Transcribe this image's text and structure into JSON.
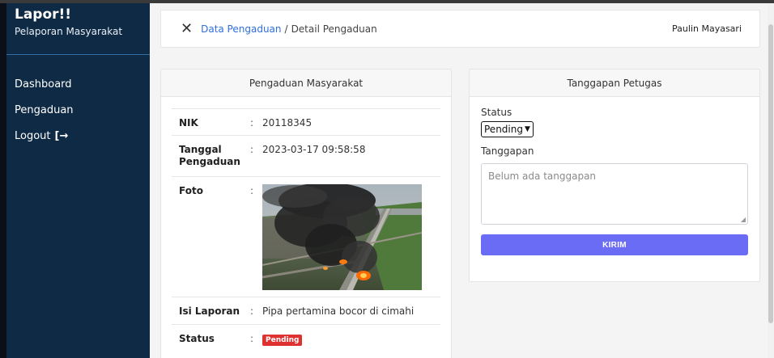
{
  "sidebar": {
    "brand_title": "Lapor!!",
    "brand_subtitle": "Pelaporan Masyarakat",
    "items": [
      {
        "label": "Dashboard"
      },
      {
        "label": "Pengaduan"
      },
      {
        "label": "Logout",
        "icon": "logout-arrow-icon",
        "icon_glyph": "[→"
      }
    ]
  },
  "header": {
    "close_glyph": "✕",
    "breadcrumb_link": "Data Pengaduan",
    "breadcrumb_sep": "/",
    "breadcrumb_current": "Detail Pengaduan",
    "user_name": "Paulin Mayasari"
  },
  "complaint": {
    "title": "Pengaduan Masyarakat",
    "colon": ":",
    "fields": {
      "nik_label": "NIK",
      "nik_value": "20118345",
      "date_label": "Tanggal Pengaduan",
      "date_value": "2023-03-17 09:58:58",
      "photo_label": "Foto",
      "report_label": "Isi Laporan",
      "report_value": "Pipa pertamina bocor di cimahi",
      "status_label": "Status",
      "status_value": "Pending"
    }
  },
  "response": {
    "title": "Tanggapan Petugas",
    "status_label": "Status",
    "status_selected": "Pending",
    "response_label": "Tanggapan",
    "response_placeholder": "Belum ada tanggapan",
    "submit_label": "KIRIM"
  },
  "colors": {
    "sidebar_bg": "#0f2a45",
    "link": "#2d6fe0",
    "submit_bg": "#6b6cf6",
    "badge_bg": "#e03131"
  }
}
